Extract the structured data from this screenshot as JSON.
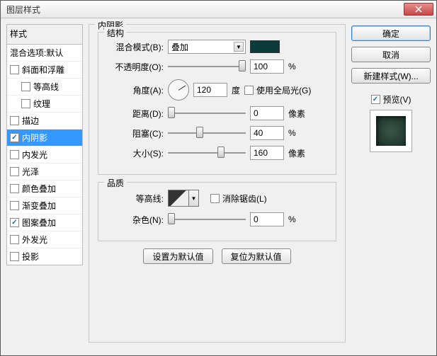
{
  "title": "图层样式",
  "leftPanel": {
    "header": "样式",
    "items": [
      {
        "label": "混合选项:默认",
        "checked": null
      },
      {
        "label": "斜面和浮雕",
        "checked": false
      },
      {
        "label": "等高线",
        "checked": false,
        "indent": true
      },
      {
        "label": "纹理",
        "checked": false,
        "indent": true
      },
      {
        "label": "描边",
        "checked": false
      },
      {
        "label": "内阴影",
        "checked": true,
        "selected": true
      },
      {
        "label": "内发光",
        "checked": false
      },
      {
        "label": "光泽",
        "checked": false
      },
      {
        "label": "颜色叠加",
        "checked": false
      },
      {
        "label": "渐变叠加",
        "checked": false
      },
      {
        "label": "图案叠加",
        "checked": true
      },
      {
        "label": "外发光",
        "checked": false
      },
      {
        "label": "投影",
        "checked": false
      }
    ]
  },
  "middle": {
    "sectionTitle": "内阴影",
    "structureTitle": "结构",
    "blendModeLabel": "混合模式(B):",
    "blendModeValue": "叠加",
    "opacityLabel": "不透明度(O):",
    "opacityValue": "100",
    "percent": "%",
    "angleLabel": "角度(A):",
    "angleValue": "120",
    "degree": "度",
    "globalLightLabel": "使用全局光(G)",
    "distanceLabel": "距离(D):",
    "distanceValue": "0",
    "px": "像素",
    "chokeLabel": "阻塞(C):",
    "chokeValue": "40",
    "sizeLabel": "大小(S):",
    "sizeValue": "160",
    "qualityTitle": "品质",
    "contourLabel": "等高线:",
    "antiAliasLabel": "消除锯齿(L)",
    "noiseLabel": "杂色(N):",
    "noiseValue": "0",
    "resetDefault": "设置为默认值",
    "restoreDefault": "复位为默认值",
    "swatchColor": "#0d3a3a"
  },
  "right": {
    "ok": "确定",
    "cancel": "取消",
    "newStyle": "新建样式(W)...",
    "previewLabel": "预览(V)"
  }
}
